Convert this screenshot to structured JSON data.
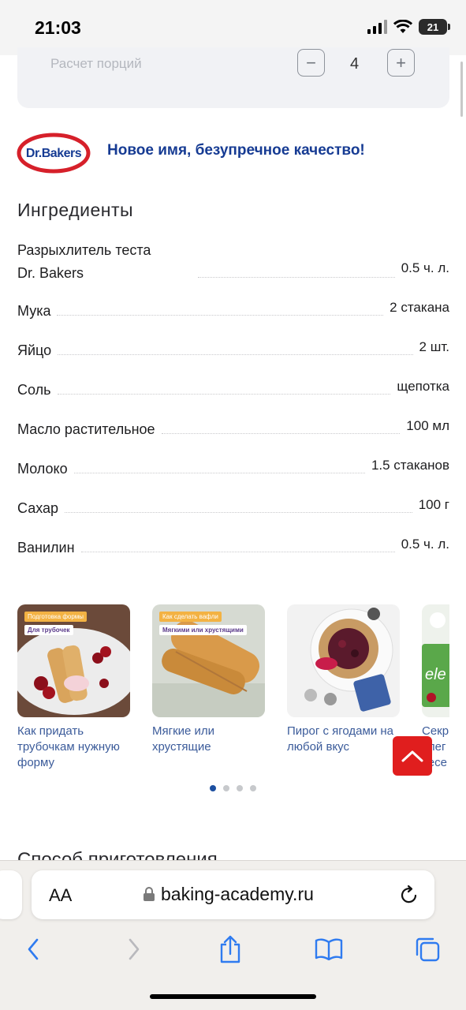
{
  "status": {
    "time": "21:03",
    "battery": "21"
  },
  "portions": {
    "label": "Расчет порций",
    "minus": "−",
    "plus": "+",
    "value": "4"
  },
  "brand": {
    "logo_text": "Dr.Bakers",
    "slogan": "Новое имя, безупречное качество!"
  },
  "ingredients": {
    "title": "Ингредиенты",
    "items": [
      {
        "name_line1": "Разрыхлитель теста",
        "name_line2": "Dr. Bakers",
        "qty": "0.5 ч. л."
      },
      {
        "name": "Мука",
        "qty": "2 стакана"
      },
      {
        "name": "Яйцо",
        "qty": "2 шт."
      },
      {
        "name": "Соль",
        "qty": "щепотка"
      },
      {
        "name": "Масло растительное",
        "qty": "100 мл"
      },
      {
        "name": "Молоко",
        "qty": "1.5 стаканов"
      },
      {
        "name": "Сахар",
        "qty": "100 г"
      },
      {
        "name": "Ванилин",
        "qty": "0.5 ч. л."
      }
    ]
  },
  "carousel": {
    "cards": [
      {
        "tag1": "Подготовка формы",
        "tag2": "Для трубочек",
        "caption": "Как придать трубочкам нужную форму"
      },
      {
        "tag1": "Как сделать вафли",
        "tag2": "Мягкими или хрустящими",
        "caption": "Мягкие или хрустящие"
      },
      {
        "caption": "Пирог с ягодами на любой вкус"
      },
      {
        "caption": "Секр\nелег\nвесе"
      }
    ],
    "pages": 4,
    "active_page": 0
  },
  "next_section": {
    "title": "Способ приготовления"
  },
  "browser": {
    "aa_label": "AA",
    "url": "baking-academy.ru"
  },
  "colors": {
    "brand_blue": "#163b93",
    "brand_red": "#e01e1e",
    "link_blue": "#3b5b9a"
  }
}
